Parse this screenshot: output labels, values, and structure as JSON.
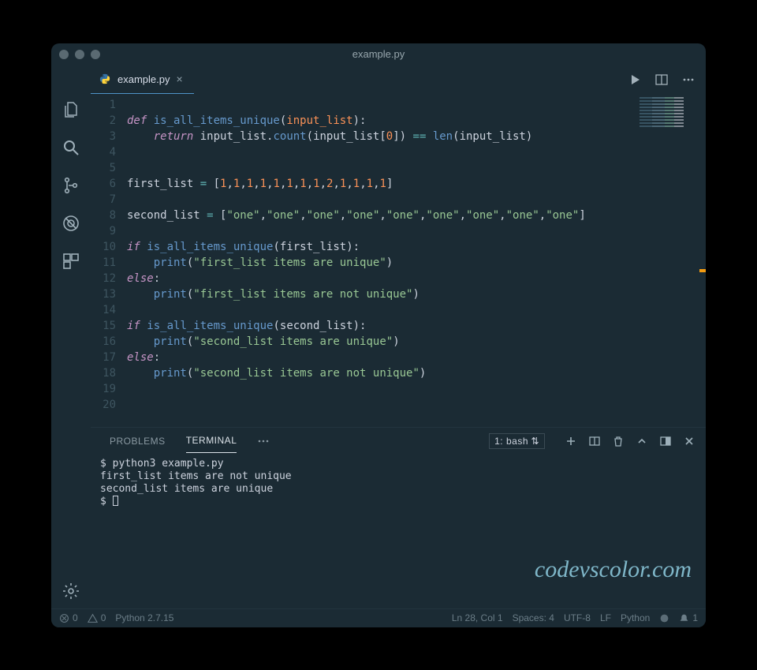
{
  "window": {
    "title": "example.py"
  },
  "tabs": [
    {
      "label": "example.py",
      "icon": "python-icon"
    }
  ],
  "activity": {
    "items": [
      "files",
      "search",
      "git",
      "debug",
      "extensions"
    ],
    "bottom": "settings"
  },
  "editor": {
    "line_start": 1,
    "line_end": 20,
    "code_lines": [
      {
        "tokens": []
      },
      {
        "tokens": [
          [
            "kw",
            "def "
          ],
          [
            "fn",
            "is_all_items_unique"
          ],
          [
            "punct",
            "("
          ],
          [
            "param",
            "input_list"
          ],
          [
            "punct",
            "):"
          ]
        ]
      },
      {
        "indent": 1,
        "tokens": [
          [
            "kw",
            "return "
          ],
          [
            "id",
            "input_list"
          ],
          [
            "punct",
            "."
          ],
          [
            "fncall",
            "count"
          ],
          [
            "punct",
            "("
          ],
          [
            "id",
            "input_list"
          ],
          [
            "punct",
            "["
          ],
          [
            "num",
            "0"
          ],
          [
            "punct",
            "]) "
          ],
          [
            "op",
            "=="
          ],
          [
            "punct",
            " "
          ],
          [
            "builtin",
            "len"
          ],
          [
            "punct",
            "("
          ],
          [
            "id",
            "input_list"
          ],
          [
            "punct",
            ")"
          ]
        ]
      },
      {
        "tokens": []
      },
      {
        "tokens": []
      },
      {
        "tokens": [
          [
            "id",
            "first_list"
          ],
          [
            "punct",
            " "
          ],
          [
            "op",
            "="
          ],
          [
            "punct",
            " ["
          ],
          [
            "num",
            "1"
          ],
          [
            "punct",
            ","
          ],
          [
            "num",
            "1"
          ],
          [
            "punct",
            ","
          ],
          [
            "num",
            "1"
          ],
          [
            "punct",
            ","
          ],
          [
            "num",
            "1"
          ],
          [
            "punct",
            ","
          ],
          [
            "num",
            "1"
          ],
          [
            "punct",
            ","
          ],
          [
            "num",
            "1"
          ],
          [
            "punct",
            ","
          ],
          [
            "num",
            "1"
          ],
          [
            "punct",
            ","
          ],
          [
            "num",
            "1"
          ],
          [
            "punct",
            ","
          ],
          [
            "num",
            "2"
          ],
          [
            "punct",
            ","
          ],
          [
            "num",
            "1"
          ],
          [
            "punct",
            ","
          ],
          [
            "num",
            "1"
          ],
          [
            "punct",
            ","
          ],
          [
            "num",
            "1"
          ],
          [
            "punct",
            ","
          ],
          [
            "num",
            "1"
          ],
          [
            "punct",
            "]"
          ]
        ]
      },
      {
        "tokens": []
      },
      {
        "tokens": [
          [
            "id",
            "second_list"
          ],
          [
            "punct",
            " "
          ],
          [
            "op",
            "="
          ],
          [
            "punct",
            " ["
          ],
          [
            "str",
            "\"one\""
          ],
          [
            "punct",
            ","
          ],
          [
            "str",
            "\"one\""
          ],
          [
            "punct",
            ","
          ],
          [
            "str",
            "\"one\""
          ],
          [
            "punct",
            ","
          ],
          [
            "str",
            "\"one\""
          ],
          [
            "punct",
            ","
          ],
          [
            "str",
            "\"one\""
          ],
          [
            "punct",
            ","
          ],
          [
            "str",
            "\"one\""
          ],
          [
            "punct",
            ","
          ],
          [
            "str",
            "\"one\""
          ],
          [
            "punct",
            ","
          ],
          [
            "str",
            "\"one\""
          ],
          [
            "punct",
            ","
          ],
          [
            "str",
            "\"one\""
          ],
          [
            "punct",
            "]"
          ]
        ]
      },
      {
        "tokens": []
      },
      {
        "tokens": [
          [
            "kw",
            "if "
          ],
          [
            "fncall",
            "is_all_items_unique"
          ],
          [
            "punct",
            "("
          ],
          [
            "id",
            "first_list"
          ],
          [
            "punct",
            "):"
          ]
        ]
      },
      {
        "indent": 1,
        "tokens": [
          [
            "builtin",
            "print"
          ],
          [
            "punct",
            "("
          ],
          [
            "str",
            "\"first_list items are unique\""
          ],
          [
            "punct",
            ")"
          ]
        ]
      },
      {
        "tokens": [
          [
            "kw",
            "else"
          ],
          [
            "punct",
            ":"
          ]
        ]
      },
      {
        "indent": 1,
        "tokens": [
          [
            "builtin",
            "print"
          ],
          [
            "punct",
            "("
          ],
          [
            "str",
            "\"first_list items are not unique\""
          ],
          [
            "punct",
            ")"
          ]
        ]
      },
      {
        "tokens": []
      },
      {
        "tokens": [
          [
            "kw",
            "if "
          ],
          [
            "fncall",
            "is_all_items_unique"
          ],
          [
            "punct",
            "("
          ],
          [
            "id",
            "second_list"
          ],
          [
            "punct",
            "):"
          ]
        ]
      },
      {
        "indent": 1,
        "tokens": [
          [
            "builtin",
            "print"
          ],
          [
            "punct",
            "("
          ],
          [
            "str",
            "\"second_list items are unique\""
          ],
          [
            "punct",
            ")"
          ]
        ]
      },
      {
        "tokens": [
          [
            "kw",
            "else"
          ],
          [
            "punct",
            ":"
          ]
        ]
      },
      {
        "indent": 1,
        "tokens": [
          [
            "builtin",
            "print"
          ],
          [
            "punct",
            "("
          ],
          [
            "str",
            "\"second_list items are not unique\""
          ],
          [
            "punct",
            ")"
          ]
        ]
      },
      {
        "tokens": []
      },
      {
        "tokens": []
      }
    ]
  },
  "panel": {
    "tabs": [
      "PROBLEMS",
      "TERMINAL"
    ],
    "active_tab": 1,
    "terminal_selector": "1: bash",
    "terminal_lines": [
      "$ python3 example.py",
      "first_list items are not unique",
      "second_list items are unique"
    ],
    "prompt": "$ "
  },
  "watermark": "codevscolor.com",
  "status": {
    "errors": "0",
    "warnings": "0",
    "python": "Python 2.7.15",
    "position": "Ln 28, Col 1",
    "spaces": "Spaces: 4",
    "encoding": "UTF-8",
    "eol": "LF",
    "language": "Python",
    "bell": "1"
  }
}
